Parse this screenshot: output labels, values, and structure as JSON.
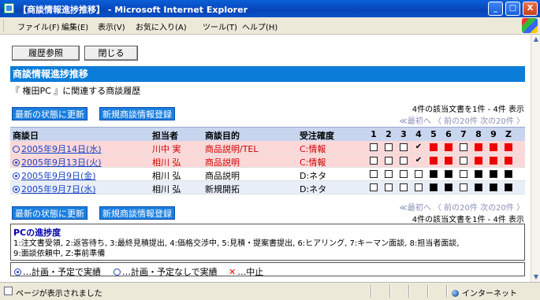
{
  "window": {
    "title": "【商談情報進捗推移】 - Microsoft Internet Explorer",
    "buttons": [
      "_",
      "□",
      "X"
    ]
  },
  "menubar": {
    "items": [
      "ファイル(F)",
      "編集(E)",
      "表示(V)",
      "お気に入り(A)",
      "ツール(T)",
      "ヘルプ(H)"
    ]
  },
  "toolbar": {
    "history_label": "履歴参照",
    "close_label": "閉じる"
  },
  "section": {
    "title": "商談情報進捗推移",
    "subtitle": "『 権田PC 』に関連する商談履歴"
  },
  "actions": {
    "refresh_label": "最新の状態に更新",
    "new_label": "新規商談情報登録"
  },
  "pager": {
    "info": "4件の該当文書を1件 - 4件  表示",
    "nav": "≪最初へ  〈 前の20件  次の20件 〉"
  },
  "table": {
    "headers": {
      "date": "商談日",
      "owner": "担当者",
      "purpose": "商談目的",
      "certainty": "受注確度"
    },
    "stage_numbers": [
      "1",
      "2",
      "3",
      "4",
      "5",
      "6",
      "7",
      "8",
      "9",
      "Z"
    ],
    "rows": [
      {
        "date": "2005年9月14日(水)",
        "owner": "川中 実",
        "purpose": "商品説明/TEL",
        "certainty": "C:情報",
        "highlight": "#fdd8d8",
        "text_color": "#cc0000",
        "icon": "single",
        "stages": [
          "empty",
          "empty",
          "empty",
          "check",
          "filled",
          "filled",
          "empty",
          "filled",
          "filled",
          "filled"
        ],
        "stage_color": "red"
      },
      {
        "date": "2005年9月13日(火)",
        "owner": "相川 弘",
        "purpose": "商品説明",
        "certainty": "C:情報",
        "highlight": "#fdd8d8",
        "text_color": "#cc0000",
        "icon": "double",
        "stages": [
          "empty",
          "empty",
          "empty",
          "check",
          "filled",
          "filled",
          "empty",
          "filled",
          "filled",
          "filled"
        ],
        "stage_color": "red"
      },
      {
        "date": "2005年9月9日(金)",
        "owner": "相川 弘",
        "purpose": "商品説明",
        "certainty": "D:ネタ",
        "highlight": "#ffffff",
        "text_color": "#000000",
        "icon": "double",
        "stages": [
          "empty",
          "empty",
          "empty",
          "empty",
          "filled",
          "filled",
          "empty",
          "filled",
          "filled",
          "filled"
        ],
        "stage_color": "black"
      },
      {
        "date": "2005年9月7日(水)",
        "owner": "相川 弘",
        "purpose": "新規開拓",
        "certainty": "D:ネタ",
        "highlight": "#e8eef8",
        "text_color": "#000000",
        "icon": "double",
        "stages": [
          "empty",
          "empty",
          "empty",
          "empty",
          "filled",
          "filled",
          "empty",
          "filled",
          "filled",
          "filled"
        ],
        "stage_color": "black"
      }
    ]
  },
  "progress": {
    "title": "PCの進捗度",
    "line1": "1:注文書受領, 2:返答待ち, 3:最終見積提出, 4:価格交渉中, 5:見積・提案書提出, 6:ヒアリング, 7:キーマン面談, 8:担当者面談,",
    "line2": "9:面談依頼中, Z:事前準備"
  },
  "legend": {
    "item1": "…計画・予定で実績",
    "item2": "…計画・予定なしで実績",
    "item3": "…中止"
  },
  "statusbar": {
    "text": "ページが表示されました",
    "zone": "インターネット"
  },
  "colors": {
    "section": "#0b7dd8",
    "header_row": "#c8d5ee",
    "red": "#e00000"
  }
}
